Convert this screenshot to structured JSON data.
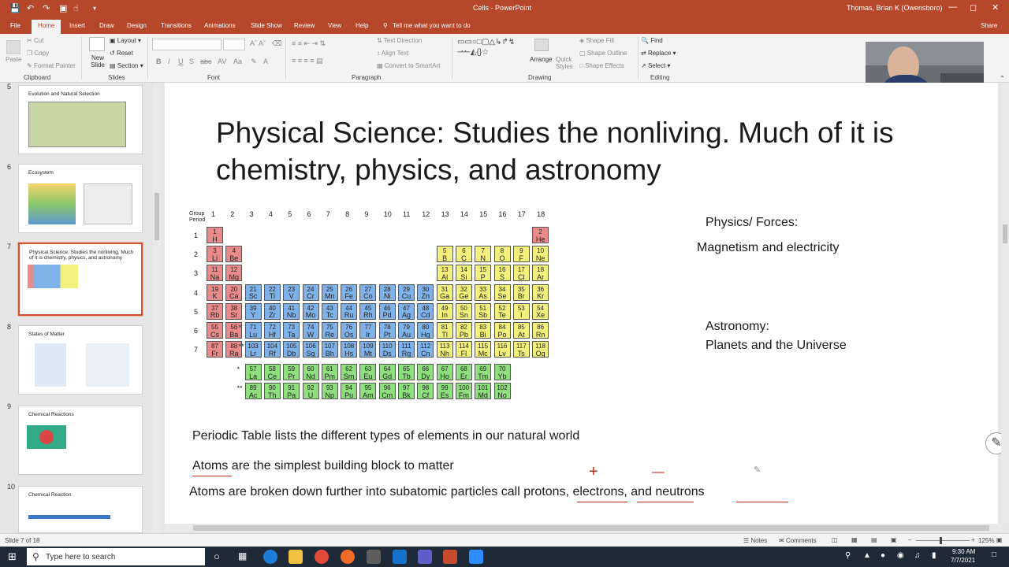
{
  "titlebar": {
    "doc_title": "Cells - PowerPoint",
    "user": "Thomas, Brian K (Owensboro)"
  },
  "tabs": [
    {
      "label": "File"
    },
    {
      "label": "Home"
    },
    {
      "label": "Insert"
    },
    {
      "label": "Draw"
    },
    {
      "label": "Design"
    },
    {
      "label": "Transitions"
    },
    {
      "label": "Animations"
    },
    {
      "label": "Slide Show"
    },
    {
      "label": "Review"
    },
    {
      "label": "View"
    },
    {
      "label": "Help"
    },
    {
      "label": "Tell me what you want to do"
    },
    {
      "label": "Share"
    }
  ],
  "ribbon": {
    "clipboard": {
      "paste": "Paste",
      "cut": "Cut",
      "copy": "Copy",
      "format_painter": "Format Painter",
      "label": "Clipboard"
    },
    "slides": {
      "new_slide": "New Slide",
      "layout": "Layout",
      "reset": "Reset",
      "section": "Section",
      "label": "Slides"
    },
    "font": {
      "label": "Font"
    },
    "paragraph": {
      "text_direction": "Text Direction",
      "align_text": "Align Text",
      "convert_smartart": "Convert to SmartArt",
      "label": "Paragraph"
    },
    "drawing": {
      "arrange": "Arrange",
      "quick_styles": "Quick Styles",
      "shape_fill": "Shape Fill",
      "shape_outline": "Shape Outline",
      "shape_effects": "Shape Effects",
      "label": "Drawing"
    },
    "editing": {
      "find": "Find",
      "replace": "Replace",
      "select": "Select",
      "label": "Editing"
    }
  },
  "thumbnails": [
    {
      "num": "5",
      "title": "Evolution and Natural Selection"
    },
    {
      "num": "6",
      "title": "Ecosystem"
    },
    {
      "num": "7",
      "title": "Physical Science:  Studies the nonliving.  Much of it is chemistry, physics, and astronomy"
    },
    {
      "num": "8",
      "title": "States of Matter"
    },
    {
      "num": "9",
      "title": "Chemical Reactions"
    },
    {
      "num": "10",
      "title": "Chemical Reaction"
    }
  ],
  "slide": {
    "title": "Physical Science:  Studies the nonliving.  Much of it is chemistry, physics, and astronomy",
    "physics_heading": "Physics/ Forces:",
    "physics_body": "Magnetism and electricity",
    "astronomy_heading": "Astronomy:",
    "astronomy_body": "Planets and the Universe",
    "line1": "Periodic Table lists the different types of elements in our natural world",
    "line2": "Atoms are the simplest building block to matter",
    "line3": "Atoms are broken down further into subatomic particles call protons, electrons, and neutrons",
    "ink_plus": "+",
    "ink_minus": "—"
  },
  "ptable": {
    "group_label": "Group",
    "period_label": "Period",
    "groups": [
      "1",
      "2",
      "3",
      "4",
      "5",
      "6",
      "7",
      "8",
      "9",
      "10",
      "11",
      "12",
      "13",
      "14",
      "15",
      "16",
      "17",
      "18"
    ],
    "periods": [
      "1",
      "2",
      "3",
      "4",
      "5",
      "6",
      "7"
    ],
    "elements": [
      [
        "1",
        "H",
        1,
        1,
        "red"
      ],
      [
        "2",
        "He",
        18,
        1,
        "red"
      ],
      [
        "3",
        "Li",
        1,
        2,
        "red"
      ],
      [
        "4",
        "Be",
        2,
        2,
        "red"
      ],
      [
        "5",
        "B",
        13,
        2,
        "yel"
      ],
      [
        "6",
        "C",
        14,
        2,
        "yel"
      ],
      [
        "7",
        "N",
        15,
        2,
        "yel"
      ],
      [
        "8",
        "O",
        16,
        2,
        "yel"
      ],
      [
        "9",
        "F",
        17,
        2,
        "yel"
      ],
      [
        "10",
        "Ne",
        18,
        2,
        "yel"
      ],
      [
        "11",
        "Na",
        1,
        3,
        "red"
      ],
      [
        "12",
        "Mg",
        2,
        3,
        "red"
      ],
      [
        "13",
        "Al",
        13,
        3,
        "yel"
      ],
      [
        "14",
        "Si",
        14,
        3,
        "yel"
      ],
      [
        "15",
        "P",
        15,
        3,
        "yel"
      ],
      [
        "16",
        "S",
        16,
        3,
        "yel"
      ],
      [
        "17",
        "Cl",
        17,
        3,
        "yel"
      ],
      [
        "18",
        "Ar",
        18,
        3,
        "yel"
      ],
      [
        "19",
        "K",
        1,
        4,
        "red"
      ],
      [
        "20",
        "Ca",
        2,
        4,
        "red"
      ],
      [
        "21",
        "Sc",
        3,
        4,
        "blue"
      ],
      [
        "22",
        "Ti",
        4,
        4,
        "blue"
      ],
      [
        "23",
        "V",
        5,
        4,
        "blue"
      ],
      [
        "24",
        "Cr",
        6,
        4,
        "blue"
      ],
      [
        "25",
        "Mn",
        7,
        4,
        "blue"
      ],
      [
        "26",
        "Fe",
        8,
        4,
        "blue"
      ],
      [
        "27",
        "Co",
        9,
        4,
        "blue"
      ],
      [
        "28",
        "Ni",
        10,
        4,
        "blue"
      ],
      [
        "29",
        "Cu",
        11,
        4,
        "blue"
      ],
      [
        "30",
        "Zn",
        12,
        4,
        "blue"
      ],
      [
        "31",
        "Ga",
        13,
        4,
        "yel"
      ],
      [
        "32",
        "Ge",
        14,
        4,
        "yel"
      ],
      [
        "33",
        "As",
        15,
        4,
        "yel"
      ],
      [
        "34",
        "Se",
        16,
        4,
        "yel"
      ],
      [
        "35",
        "Br",
        17,
        4,
        "yel"
      ],
      [
        "36",
        "Kr",
        18,
        4,
        "yel"
      ],
      [
        "37",
        "Rb",
        1,
        5,
        "red"
      ],
      [
        "38",
        "Sr",
        2,
        5,
        "red"
      ],
      [
        "39",
        "Y",
        3,
        5,
        "blue"
      ],
      [
        "40",
        "Zr",
        4,
        5,
        "blue"
      ],
      [
        "41",
        "Nb",
        5,
        5,
        "blue"
      ],
      [
        "42",
        "Mo",
        6,
        5,
        "blue"
      ],
      [
        "43",
        "Tc",
        7,
        5,
        "blue"
      ],
      [
        "44",
        "Ru",
        8,
        5,
        "blue"
      ],
      [
        "45",
        "Rh",
        9,
        5,
        "blue"
      ],
      [
        "46",
        "Pd",
        10,
        5,
        "blue"
      ],
      [
        "47",
        "Ag",
        11,
        5,
        "blue"
      ],
      [
        "48",
        "Cd",
        12,
        5,
        "blue"
      ],
      [
        "49",
        "In",
        13,
        5,
        "yel"
      ],
      [
        "50",
        "Sn",
        14,
        5,
        "yel"
      ],
      [
        "51",
        "Sb",
        15,
        5,
        "yel"
      ],
      [
        "52",
        "Te",
        16,
        5,
        "yel"
      ],
      [
        "53",
        "I",
        17,
        5,
        "yel"
      ],
      [
        "54",
        "Xe",
        18,
        5,
        "yel"
      ],
      [
        "55",
        "Cs",
        1,
        6,
        "red"
      ],
      [
        "56",
        "Ba",
        2,
        6,
        "red"
      ],
      [
        "71",
        "Lu",
        3,
        6,
        "blue"
      ],
      [
        "72",
        "Hf",
        4,
        6,
        "blue"
      ],
      [
        "73",
        "Ta",
        5,
        6,
        "blue"
      ],
      [
        "74",
        "W",
        6,
        6,
        "blue"
      ],
      [
        "75",
        "Re",
        7,
        6,
        "blue"
      ],
      [
        "76",
        "Os",
        8,
        6,
        "blue"
      ],
      [
        "77",
        "Ir",
        9,
        6,
        "blue"
      ],
      [
        "78",
        "Pt",
        10,
        6,
        "blue"
      ],
      [
        "79",
        "Au",
        11,
        6,
        "blue"
      ],
      [
        "80",
        "Hg",
        12,
        6,
        "blue"
      ],
      [
        "81",
        "Tl",
        13,
        6,
        "yel"
      ],
      [
        "82",
        "Pb",
        14,
        6,
        "yel"
      ],
      [
        "83",
        "Bi",
        15,
        6,
        "yel"
      ],
      [
        "84",
        "Po",
        16,
        6,
        "yel"
      ],
      [
        "85",
        "At",
        17,
        6,
        "yel"
      ],
      [
        "86",
        "Rn",
        18,
        6,
        "yel"
      ],
      [
        "87",
        "Fr",
        1,
        7,
        "red"
      ],
      [
        "88",
        "Ra",
        2,
        7,
        "red"
      ],
      [
        "103",
        "Lr",
        3,
        7,
        "blue"
      ],
      [
        "104",
        "Rf",
        4,
        7,
        "blue"
      ],
      [
        "105",
        "Db",
        5,
        7,
        "blue"
      ],
      [
        "106",
        "Sg",
        6,
        7,
        "blue"
      ],
      [
        "107",
        "Bh",
        7,
        7,
        "blue"
      ],
      [
        "108",
        "Hs",
        8,
        7,
        "blue"
      ],
      [
        "109",
        "Mt",
        9,
        7,
        "blue"
      ],
      [
        "110",
        "Ds",
        10,
        7,
        "blue"
      ],
      [
        "111",
        "Rg",
        11,
        7,
        "blue"
      ],
      [
        "112",
        "Cn",
        12,
        7,
        "blue"
      ],
      [
        "113",
        "Nh",
        13,
        7,
        "yel"
      ],
      [
        "114",
        "Fl",
        14,
        7,
        "yel"
      ],
      [
        "115",
        "Mc",
        15,
        7,
        "yel"
      ],
      [
        "116",
        "Lv",
        16,
        7,
        "yel"
      ],
      [
        "117",
        "Ts",
        17,
        7,
        "yel"
      ],
      [
        "118",
        "Og",
        18,
        7,
        "yel"
      ],
      [
        "57",
        "La",
        3,
        8,
        "grn"
      ],
      [
        "58",
        "Ce",
        4,
        8,
        "grn"
      ],
      [
        "59",
        "Pr",
        5,
        8,
        "grn"
      ],
      [
        "60",
        "Nd",
        6,
        8,
        "grn"
      ],
      [
        "61",
        "Pm",
        7,
        8,
        "grn"
      ],
      [
        "62",
        "Sm",
        8,
        8,
        "grn"
      ],
      [
        "63",
        "Eu",
        9,
        8,
        "grn"
      ],
      [
        "64",
        "Gd",
        10,
        8,
        "grn"
      ],
      [
        "65",
        "Tb",
        11,
        8,
        "grn"
      ],
      [
        "66",
        "Dy",
        12,
        8,
        "grn"
      ],
      [
        "67",
        "Ho",
        13,
        8,
        "grn"
      ],
      [
        "68",
        "Er",
        14,
        8,
        "grn"
      ],
      [
        "69",
        "Tm",
        15,
        8,
        "grn"
      ],
      [
        "70",
        "Yb",
        16,
        8,
        "grn"
      ],
      [
        "89",
        "Ac",
        3,
        9,
        "grn"
      ],
      [
        "90",
        "Th",
        4,
        9,
        "grn"
      ],
      [
        "91",
        "Pa",
        5,
        9,
        "grn"
      ],
      [
        "92",
        "U",
        6,
        9,
        "grn"
      ],
      [
        "93",
        "Np",
        7,
        9,
        "grn"
      ],
      [
        "94",
        "Pu",
        8,
        9,
        "grn"
      ],
      [
        "95",
        "Am",
        9,
        9,
        "grn"
      ],
      [
        "96",
        "Cm",
        10,
        9,
        "grn"
      ],
      [
        "97",
        "Bk",
        11,
        9,
        "grn"
      ],
      [
        "98",
        "Cf",
        12,
        9,
        "grn"
      ],
      [
        "99",
        "Es",
        13,
        9,
        "grn"
      ],
      [
        "100",
        "Fm",
        14,
        9,
        "grn"
      ],
      [
        "101",
        "Md",
        15,
        9,
        "grn"
      ],
      [
        "102",
        "No",
        16,
        9,
        "grn"
      ]
    ]
  },
  "statusbar": {
    "slide_count": "Slide 7 of 18",
    "notes": "Notes",
    "comments": "Comments",
    "zoom": "125%"
  },
  "taskbar": {
    "search_placeholder": "Type here to search",
    "time": "9:30 AM",
    "date": "7/7/2021"
  },
  "colors": {
    "accent": "#b7472a",
    "red": "#e98b8b",
    "blue": "#7fb2e8",
    "yellow": "#f3ef7c",
    "green": "#8fdf7e",
    "ink": "#c5281c"
  }
}
